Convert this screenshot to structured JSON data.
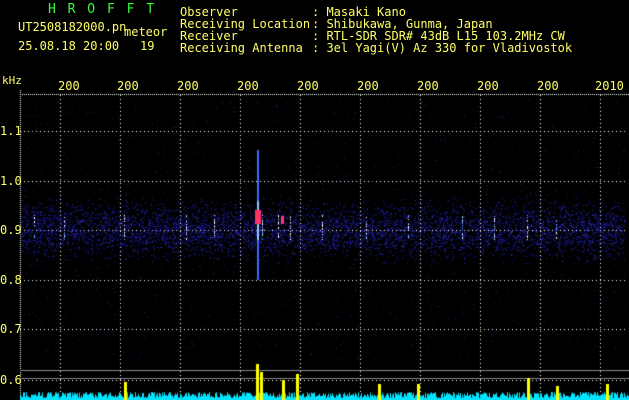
{
  "header": {
    "app_title": "H R O F F T",
    "filename": "UT2508182000.pn",
    "meteor_label": "meteor",
    "datetime": "25.08.18 20:00",
    "meteor_count": "19",
    "labels": [
      "Observer",
      "Receiving Location",
      "Receiver",
      "Receiving Antenna"
    ],
    "values": [
      ": Masaki Kano",
      ": Shibukawa, Gunma, Japan",
      ": RTL-SDR SDR# 43dB L15 103.2MHz CW",
      ": 3el Yagi(V) Az 330 for Vladivostok"
    ]
  },
  "axis": {
    "unit": "kHz",
    "y_ticks": [
      "1.1",
      "1.0",
      "0.9",
      "0.8",
      "0.7",
      "0.6"
    ],
    "x_ticks": [
      "200",
      "200",
      "200",
      "200",
      "200",
      "200",
      "200",
      "200",
      "200",
      "2010"
    ]
  },
  "colors": {
    "grid": "#ffffff",
    "text": "#ffff66",
    "title": "#33ff33",
    "signal": "#3333ff",
    "meteor": "#ff3366",
    "spectrum": "#00e5ff",
    "peak": "#ffff00"
  }
}
